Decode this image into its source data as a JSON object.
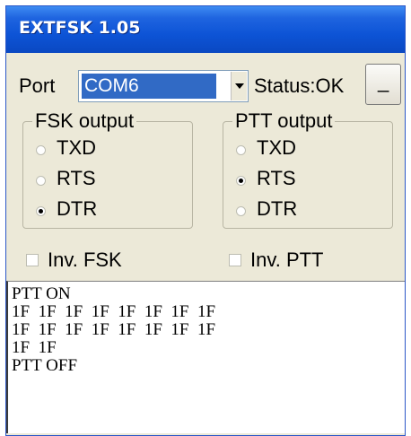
{
  "window": {
    "title": "EXTFSK 1.05"
  },
  "port": {
    "label": "Port",
    "value": "COM6"
  },
  "status": {
    "text": "Status:OK"
  },
  "minimize_button": {
    "label": "_"
  },
  "fsk_group": {
    "title": "FSK output",
    "options": [
      {
        "label": "TXD",
        "selected": false
      },
      {
        "label": "RTS",
        "selected": false
      },
      {
        "label": "DTR",
        "selected": true
      }
    ]
  },
  "ptt_group": {
    "title": "PTT output",
    "options": [
      {
        "label": "TXD",
        "selected": false
      },
      {
        "label": "RTS",
        "selected": true
      },
      {
        "label": "DTR",
        "selected": false
      }
    ]
  },
  "checkboxes": {
    "inv_fsk": {
      "label": "Inv. FSK",
      "checked": false
    },
    "inv_ptt": {
      "label": "Inv. PTT",
      "checked": false
    }
  },
  "log": {
    "lines": [
      "PTT ON",
      "1F  1F  1F  1F  1F  1F  1F  1F",
      "1F  1F  1F  1F  1F  1F  1F  1F",
      "1F  1F",
      "PTT OFF"
    ]
  }
}
